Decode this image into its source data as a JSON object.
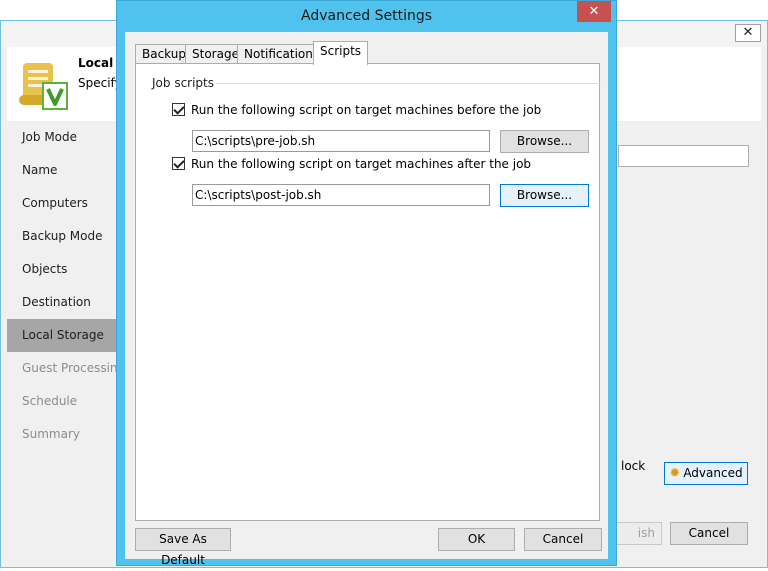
{
  "background_wizard": {
    "header_title": "Local S",
    "header_subtitle": "Specify",
    "close_glyph": "✕",
    "icon": "script-check-icon",
    "nav_items": [
      {
        "label": "Job Mode",
        "state": "normal"
      },
      {
        "label": "Name",
        "state": "normal"
      },
      {
        "label": "Computers",
        "state": "normal"
      },
      {
        "label": "Backup Mode",
        "state": "normal"
      },
      {
        "label": "Objects",
        "state": "normal"
      },
      {
        "label": "Destination",
        "state": "normal"
      },
      {
        "label": "Local Storage",
        "state": "active"
      },
      {
        "label": "Guest Processing",
        "state": "disabled"
      },
      {
        "label": "Schedule",
        "state": "disabled"
      },
      {
        "label": "Summary",
        "state": "disabled"
      }
    ],
    "partial_text": "lock",
    "advanced_label": "Advanced",
    "finish_label": "ish",
    "cancel_label": "Cancel"
  },
  "dialog": {
    "title": "Advanced Settings",
    "close_glyph": "✕",
    "tabs": [
      {
        "label": "Backup",
        "active": false
      },
      {
        "label": "Storage",
        "active": false
      },
      {
        "label": "Notifications",
        "active": false
      },
      {
        "label": "Scripts",
        "active": true
      }
    ],
    "group_label": "Job scripts",
    "before_script": {
      "checked": true,
      "label": "Run the following script on target machines before the job",
      "path": "C:\\scripts\\pre-job.sh",
      "browse_label": "Browse..."
    },
    "after_script": {
      "checked": true,
      "label": "Run the following script on target machines after the job",
      "path": "C:\\scripts\\post-job.sh",
      "browse_label": "Browse..."
    },
    "save_default_label": "Save As Default",
    "ok_label": "OK",
    "cancel_label": "Cancel"
  }
}
